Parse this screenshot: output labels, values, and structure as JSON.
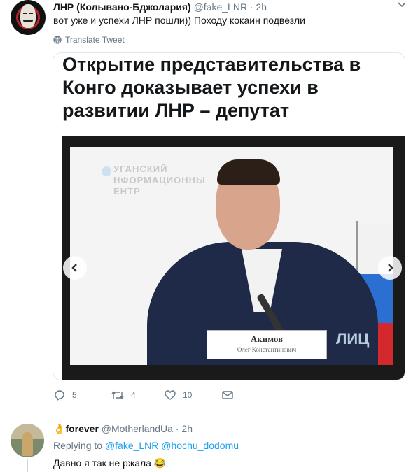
{
  "tweet": {
    "author_name": "ЛНР (Колывано-Бджолария)",
    "handle": "@fake_LNR",
    "separator": "·",
    "time": "2h",
    "text": "вот уже и успехи ЛНР пошли)) Походу кокаин подвезли",
    "translate_label": "Translate Tweet",
    "card": {
      "headline": "Открытие представительства в Конго доказывает успехи в развитии ЛНР – депутат",
      "photo": {
        "watermark_lines": [
          "УГАНСКИЙ",
          "НФОРМАЦИОННЫ",
          "ЕНТР"
        ],
        "namecard_name": "Акимов",
        "namecard_full": "Олег Константинович",
        "logo_text": "ЛИЦ"
      }
    },
    "actions": {
      "replies": "5",
      "retweets": "4",
      "likes": "10"
    }
  },
  "reply": {
    "emoji_prefix": "👌",
    "author_name": "forever",
    "handle": "@MotherlandUa",
    "separator": "·",
    "time": "2h",
    "replying_to_label": "Replying to",
    "mentions": "@fake_LNR @hochu_dodomu",
    "text": "Давно я так не ржала 😂"
  },
  "colors": {
    "accent": "#1da1f2",
    "secondary_text": "#657786",
    "border": "#e1e8ed"
  },
  "icons": [
    "caret-down-icon",
    "globe-icon",
    "reply-icon",
    "retweet-icon",
    "like-icon",
    "dm-icon",
    "chevron-left-icon",
    "chevron-right-icon"
  ]
}
